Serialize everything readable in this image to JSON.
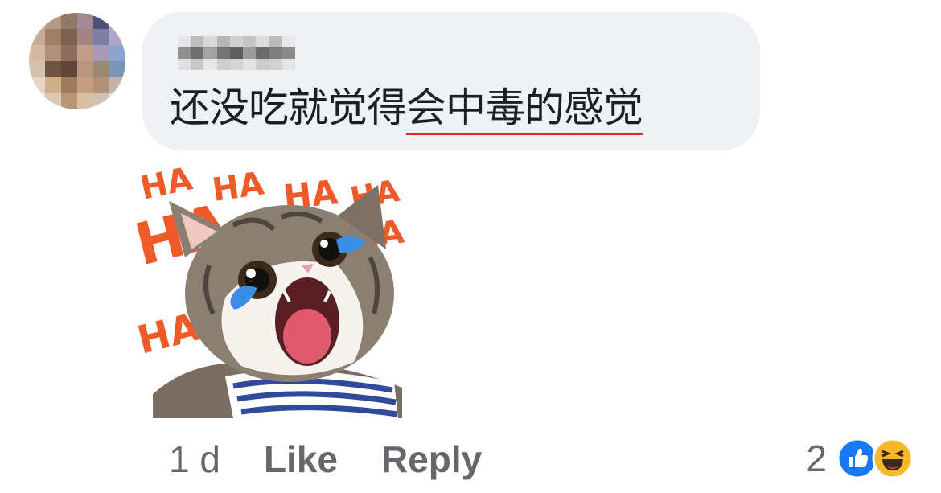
{
  "comment": {
    "text_plain": "还没吃就觉得",
    "text_underlined": "会中毒的感觉",
    "timestamp": "1 d",
    "like_label": "Like",
    "reply_label": "Reply",
    "reaction_count": "2",
    "reaction_icons": [
      "like-icon",
      "haha-icon"
    ]
  },
  "sticker": {
    "caption_words": [
      "HA",
      "HA",
      "HA",
      "HA",
      "HA",
      "HA",
      "HA"
    ],
    "colors": {
      "ha_orange": "#f05a28",
      "tear_blue": "#3a8ee6",
      "stripe_blue": "#2f4a9a"
    }
  },
  "colors": {
    "bubble_bg": "#eff1f5",
    "text": "#1c1e21",
    "meta_text": "#65676b",
    "underline_red": "#e0242f",
    "like_blue": "#1877f2",
    "haha_yellow": "#f7b928"
  }
}
